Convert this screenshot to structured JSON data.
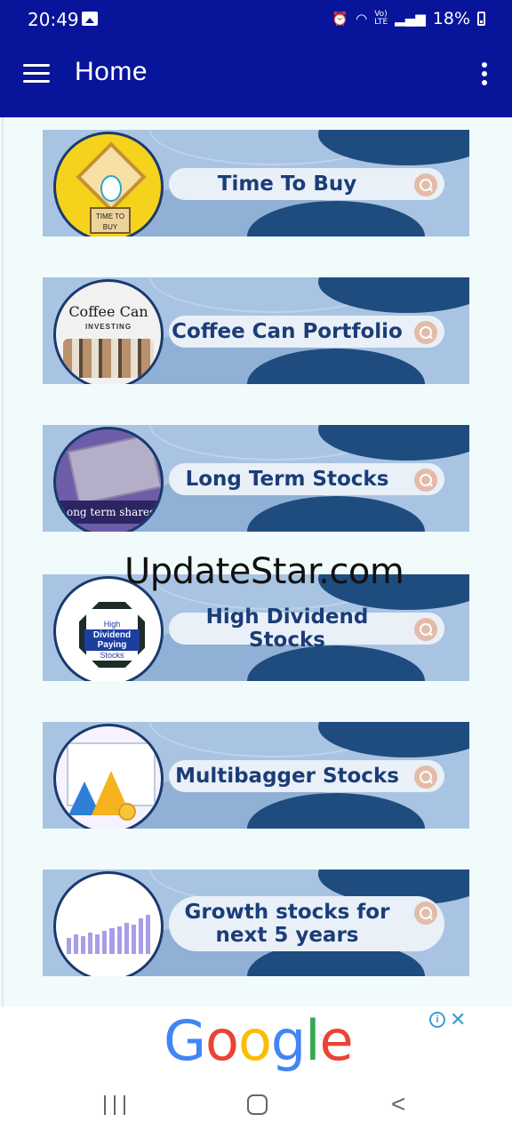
{
  "status_bar": {
    "time": "20:49",
    "battery": "18%",
    "network": "VoLTE"
  },
  "app_bar": {
    "title": "Home"
  },
  "banners": [
    {
      "label": "Time To Buy",
      "art_text": "TIME TO BUY"
    },
    {
      "label": "Coffee Can Portfolio",
      "art_title": "Coffee Can",
      "art_subtitle": "INVESTING"
    },
    {
      "label": "Long Term Stocks",
      "art_text": "Long term shares"
    },
    {
      "label": "High Dividend Stocks",
      "art_top": "High",
      "art_mid": "Dividend Paying",
      "art_bottom": "Stocks"
    },
    {
      "label": "Multibagger Stocks"
    },
    {
      "label": "Growth stocks for next 5 years"
    }
  ],
  "ad": {
    "brand": "Google"
  },
  "watermark": "UpdateStar.com",
  "colors": {
    "app_bar": "#08149a",
    "banner_bg": "#a9c4e3",
    "pill_text": "#1b3d78"
  }
}
